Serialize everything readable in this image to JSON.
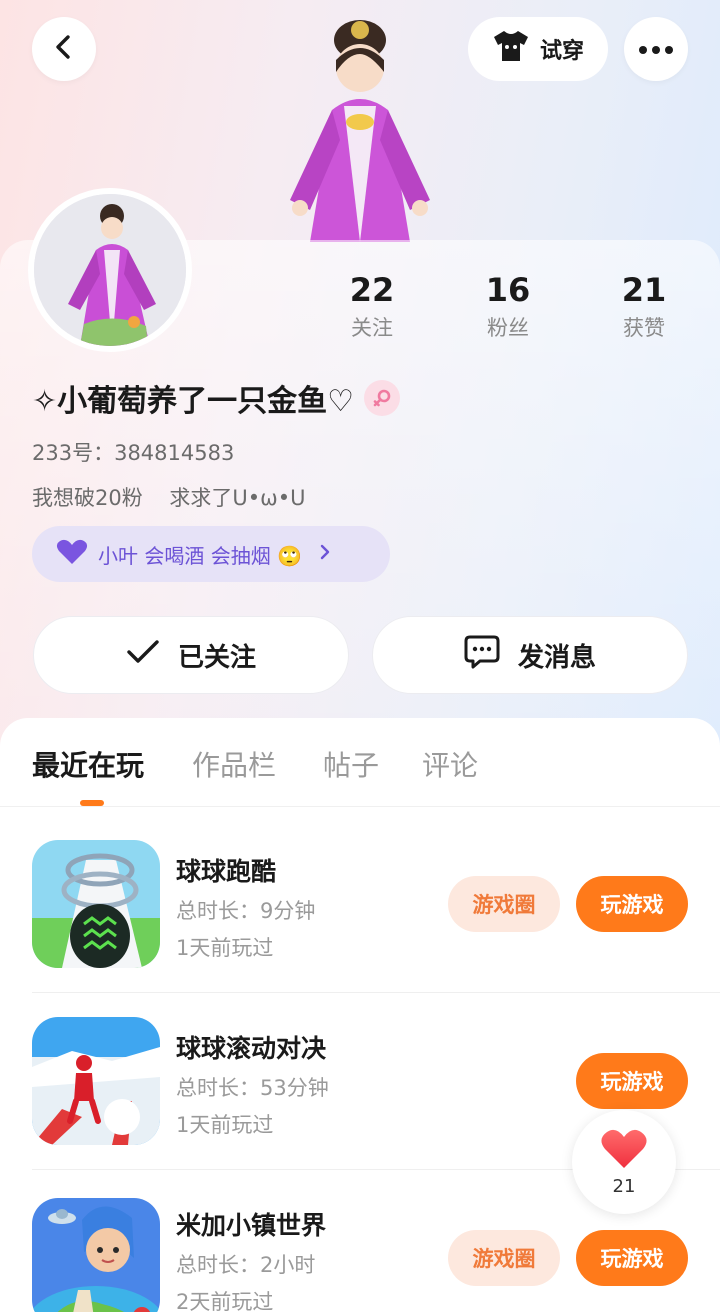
{
  "header": {
    "try_on_label": "试穿"
  },
  "stats": [
    {
      "value": "22",
      "label": "关注"
    },
    {
      "value": "16",
      "label": "粉丝"
    },
    {
      "value": "21",
      "label": "获赞"
    }
  ],
  "profile": {
    "name": "✧小葡萄养了一只金鱼♡",
    "id_line": "233号：384814583",
    "bio": "我想破20粉    求求了U•ω•U",
    "tag_text": "小叶  会喝酒 会抽烟 🙄"
  },
  "actions": {
    "follow_label": "已关注",
    "message_label": "发消息"
  },
  "tabs": [
    {
      "label": "最近在玩",
      "active": true
    },
    {
      "label": "作品栏",
      "active": false
    },
    {
      "label": "帖子",
      "active": false
    },
    {
      "label": "评论",
      "active": false
    }
  ],
  "games": [
    {
      "title": "球球跑酷",
      "duration": "总时长：9分钟",
      "last_played": "1天前玩过",
      "circle_label": "游戏圈",
      "play_label": "玩游戏"
    },
    {
      "title": "球球滚动对决",
      "duration": "总时长：53分钟",
      "last_played": "1天前玩过",
      "play_label": "玩游戏"
    },
    {
      "title": "米加小镇世界",
      "duration": "总时长：2小时",
      "last_played": "2天前玩过",
      "circle_label": "游戏圈",
      "play_label": "玩游戏"
    }
  ],
  "like_float": {
    "count": "21"
  },
  "colors": {
    "accent": "#ff7a1a",
    "accent_soft": "#fde8de",
    "tag_bg": "#e6e2f7",
    "tag_text": "#6c53d6"
  }
}
